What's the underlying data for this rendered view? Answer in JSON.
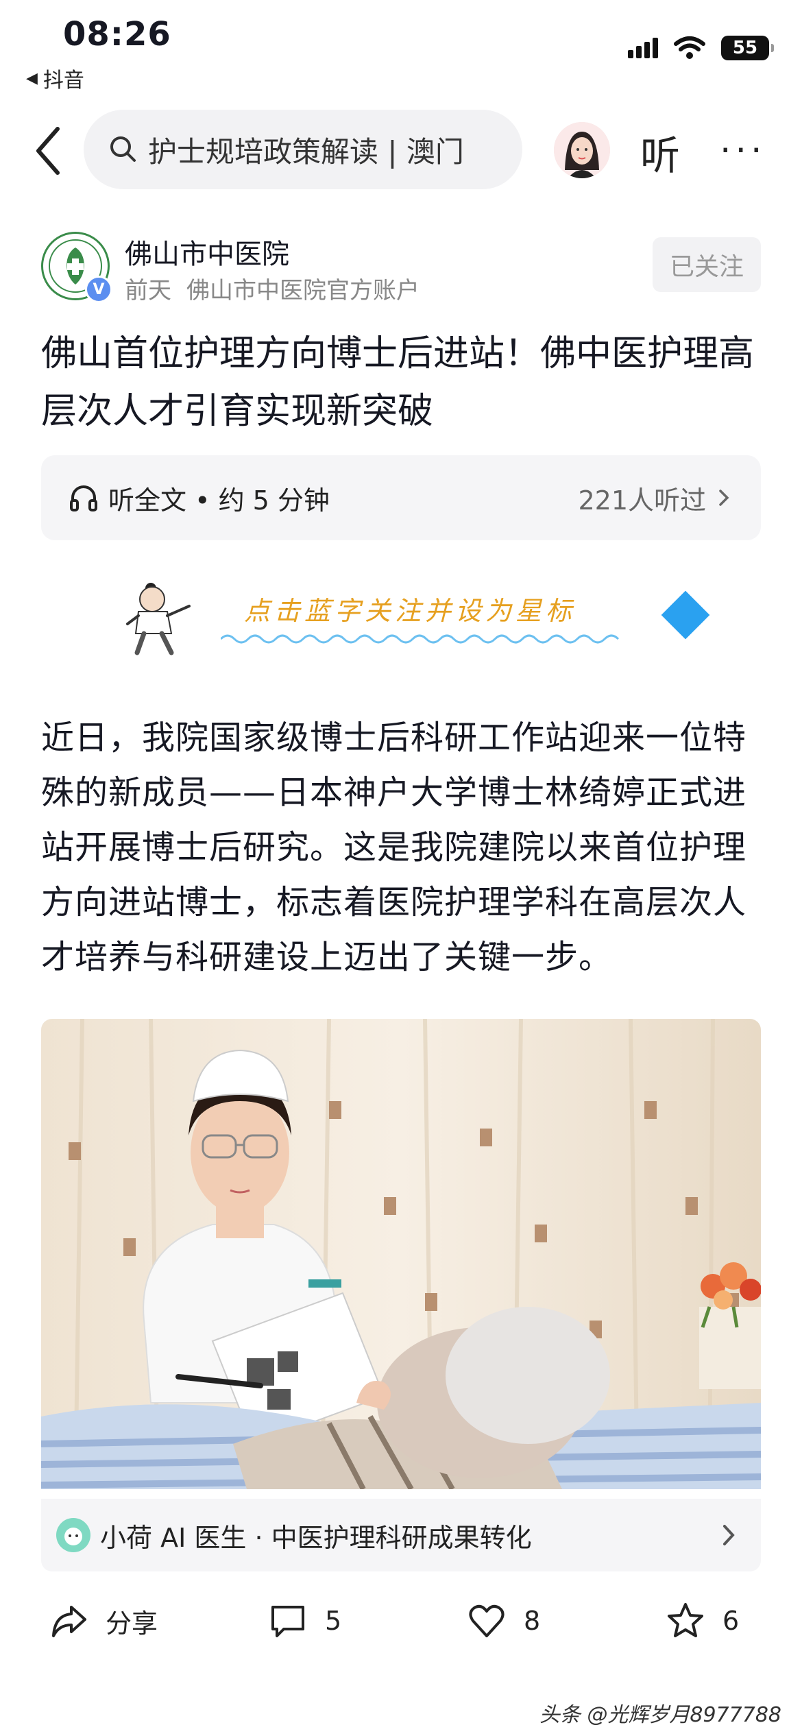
{
  "status_bar": {
    "time": "08:26",
    "back_app": "抖音",
    "battery": "55"
  },
  "nav": {
    "search_text": "护士规培政策解读 | 澳门",
    "listen_label": "听",
    "more_label": "···"
  },
  "author": {
    "name": "佛山市中医院",
    "time": "前天",
    "account_desc": "佛山市中医院官方账户",
    "follow_label": "已关注",
    "verified_label": "V"
  },
  "article": {
    "title": "佛山首位护理方向博士后进站！佛中医护理高层次人才引育实现新突破",
    "listen_label": "听全文 • 约 5 分钟",
    "listen_count": "221人听过",
    "banner_text": "点击蓝字关注并设为星标",
    "body": "近日，我院国家级博士后科研工作站迎来一位特殊的新成员——日本神户大学博士林绮婷正式进站开展博士后研究。这是我院建院以来首位护理方向进站博士，标志着医院护理学科在高层次人才培养与科研建设上迈出了关键一步。"
  },
  "ai_bar": {
    "label": "小荷 AI 医生 · 中医护理科研成果转化"
  },
  "actions": {
    "share_label": "分享",
    "comment_count": "5",
    "like_count": "8",
    "favorite_count": "6"
  },
  "watermark": "头条 @光辉岁月8977788",
  "colors": {
    "accent_blue": "#2aa1f0",
    "banner_orange": "#e6a020",
    "verified_blue": "#5b8ef0",
    "panel_gray": "#f5f5f7"
  }
}
